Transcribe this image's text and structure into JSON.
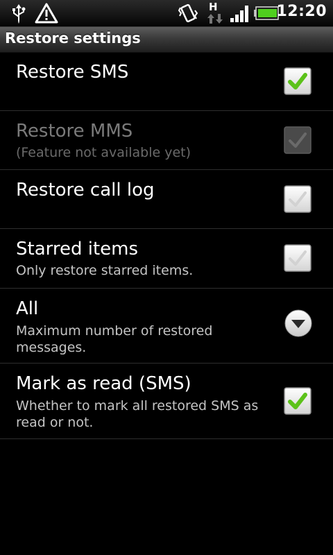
{
  "status_bar": {
    "time": "12:20",
    "network_label": "H",
    "icons": [
      "usb-icon",
      "warning-icon",
      "vibrate-icon",
      "data-transfer-icon",
      "signal-icon",
      "battery-icon"
    ]
  },
  "title_bar": {
    "title": "Restore settings"
  },
  "settings": [
    {
      "title": "Restore SMS",
      "summary": "",
      "control": "checkbox",
      "checked": true,
      "enabled": true
    },
    {
      "title": "Restore MMS",
      "summary": "(Feature not available yet)",
      "control": "checkbox",
      "checked": true,
      "enabled": false
    },
    {
      "title": "Restore call log",
      "summary": "",
      "control": "checkbox",
      "checked": false,
      "enabled": true
    },
    {
      "title": "Starred items",
      "summary": "Only restore starred items.",
      "control": "checkbox",
      "checked": false,
      "enabled": true
    },
    {
      "title": "All",
      "summary": "Maximum number of restored messages.",
      "control": "dropdown",
      "enabled": true
    },
    {
      "title": "Mark as read (SMS)",
      "summary": "Whether to mark all restored SMS as read or not.",
      "control": "checkbox",
      "checked": true,
      "enabled": true
    }
  ],
  "colors": {
    "check_green": "#5cc21a",
    "background": "#000000",
    "summary_text": "#c4c4c4"
  }
}
